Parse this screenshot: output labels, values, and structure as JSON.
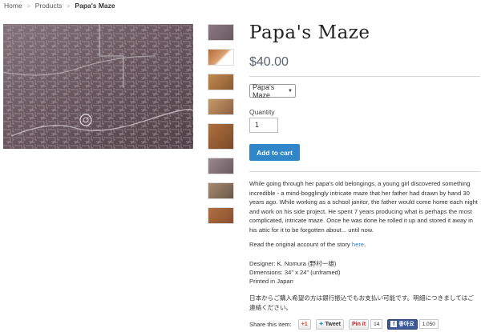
{
  "breadcrumb": {
    "home": "Home",
    "products": "Products",
    "current": "Papa's Maze"
  },
  "product": {
    "title": "Papa's Maze",
    "price": "$40.00",
    "variant": "Papa's Maze",
    "quantity_label": "Quantity",
    "quantity_value": "1",
    "add_to_cart": "Add to cart"
  },
  "description": {
    "paragraph1": "While going through her papa's old belongings, a young girl discovered something incredible - a mind-bogglingly intricate maze that her father had drawn by hand 30 years ago. While working as a school janitor, the father would come home each night and work on his side project. He spent 7 years producing what is perhaps the most complicated, intricate maze. Once he was done he rolled it up and stored it away in his attic for it to be forgotten about... until now.",
    "story_prefix": "Read the original account of the story ",
    "story_link": "here",
    "story_suffix": ".",
    "designer": "Designer: K. Nomura (野村一雄)",
    "dimensions": "Dimensions: 34\" x 24\" (unframed)",
    "printed": "Printed in Japan",
    "japanese": "日本からご購入希望の方は銀行振込でもお支払い可能です。明細につきましてはご連絡ください。"
  },
  "share": {
    "label": "Share this item:",
    "gplus": "+1",
    "tweet": "Tweet",
    "pinit": "Pin it",
    "pin_count": "14",
    "fb_like": "좋아요",
    "fb_count": "1,050"
  },
  "colors": {
    "accent": "#2f86c9",
    "facebook": "#3b5998",
    "pinterest": "#cb2027"
  },
  "icons": {
    "twitter": "bird-icon",
    "facebook": "f-icon",
    "select": "chevron-down-icon"
  }
}
